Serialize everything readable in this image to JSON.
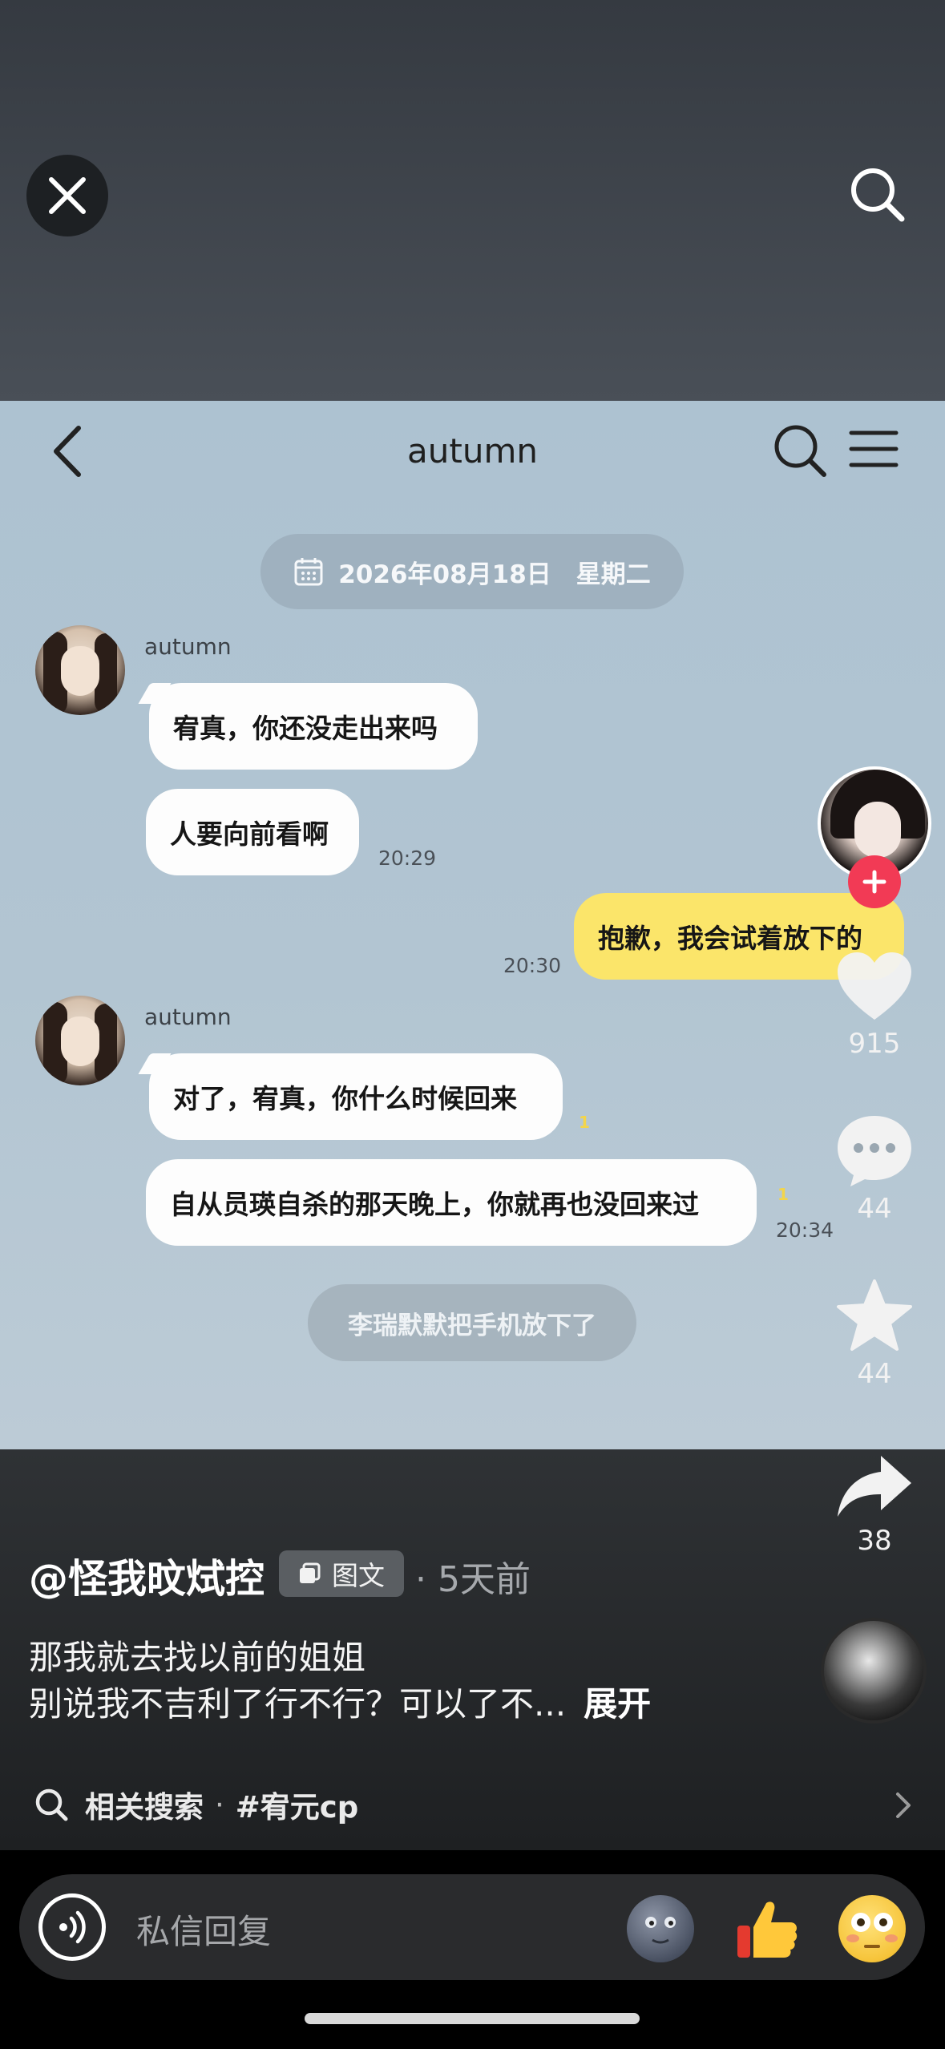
{
  "top": {
    "close_icon": "close-icon",
    "search_icon": "search-icon"
  },
  "chat": {
    "title": "autumn",
    "date_pill": "2026年08月18日　星期二",
    "sender_1": "autumn",
    "msg_1": "宥真，你还没走出来吗",
    "msg_2": "人要向前看啊",
    "time_1": "20:29",
    "msg_mine": "抱歉，我会试着放下的",
    "time_2": "20:30",
    "sender_2": "autumn",
    "msg_3": "对了，宥真，你什么时候回来",
    "read_1": "1",
    "msg_4": "自从员瑛自杀的那天晚上，你就再也没回来过",
    "read_2": "1",
    "time_3": "20:34",
    "system_msg": "李瑞默默把手机放下了"
  },
  "actions": {
    "likes": "915",
    "comments": "44",
    "favorites": "44",
    "shares": "38"
  },
  "post": {
    "author": "@怪我旼烒控",
    "type_badge": "图文",
    "time_ago": "· 5天前",
    "desc_line1": "那我就去找以前的姐姐",
    "desc_line2": "别说我不吉利了行不行？可以了不...",
    "expand": "展开"
  },
  "related": {
    "label": "相关搜索",
    "dot": "·",
    "tag": "#宥元cp"
  },
  "reply": {
    "placeholder": "私信回复"
  },
  "colors": {
    "my_bubble": "#fbe56a",
    "follow_plus": "#f23a55",
    "chat_bg": "#b2c5d2"
  }
}
